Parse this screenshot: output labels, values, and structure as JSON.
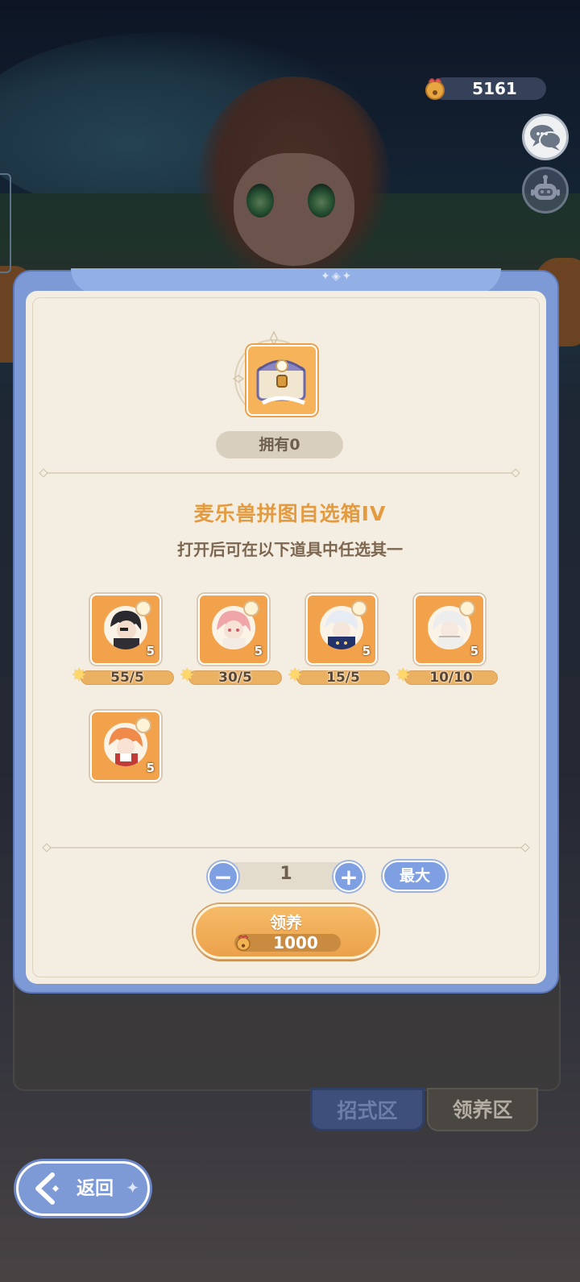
{
  "header": {
    "currency": {
      "icon": "bell-pouch-icon",
      "value": "5161"
    }
  },
  "side_buttons": [
    {
      "name": "chat",
      "icon": "chat-bubbles-icon"
    },
    {
      "name": "robot",
      "icon": "robot-icon"
    }
  ],
  "dialog": {
    "owned_label": "拥有0",
    "title": "麦乐兽拼图自选箱IV",
    "subtitle": "打开后可在以下道具中任选其一",
    "items": [
      {
        "count": "5",
        "progress": "55/5",
        "portrait": "dark-hair-character"
      },
      {
        "count": "5",
        "progress": "30/5",
        "portrait": "pink-hair-character"
      },
      {
        "count": "5",
        "progress": "15/5",
        "portrait": "white-blue-character"
      },
      {
        "count": "5",
        "progress": "10/10",
        "portrait": "white-hair-character"
      },
      {
        "count": "5",
        "progress": "",
        "portrait": "orange-hair-character"
      }
    ],
    "quantity": "1",
    "max_label": "最大",
    "adopt_label": "领养",
    "cost": "1000"
  },
  "tabs": [
    {
      "label": "招式区",
      "active": false
    },
    {
      "label": "领养区",
      "active": true
    }
  ],
  "back_label": "返回",
  "colors": {
    "dialog_blue": "#7d9ad6",
    "accent_orange": "#e49a3e",
    "paper": "#f4eee2"
  }
}
